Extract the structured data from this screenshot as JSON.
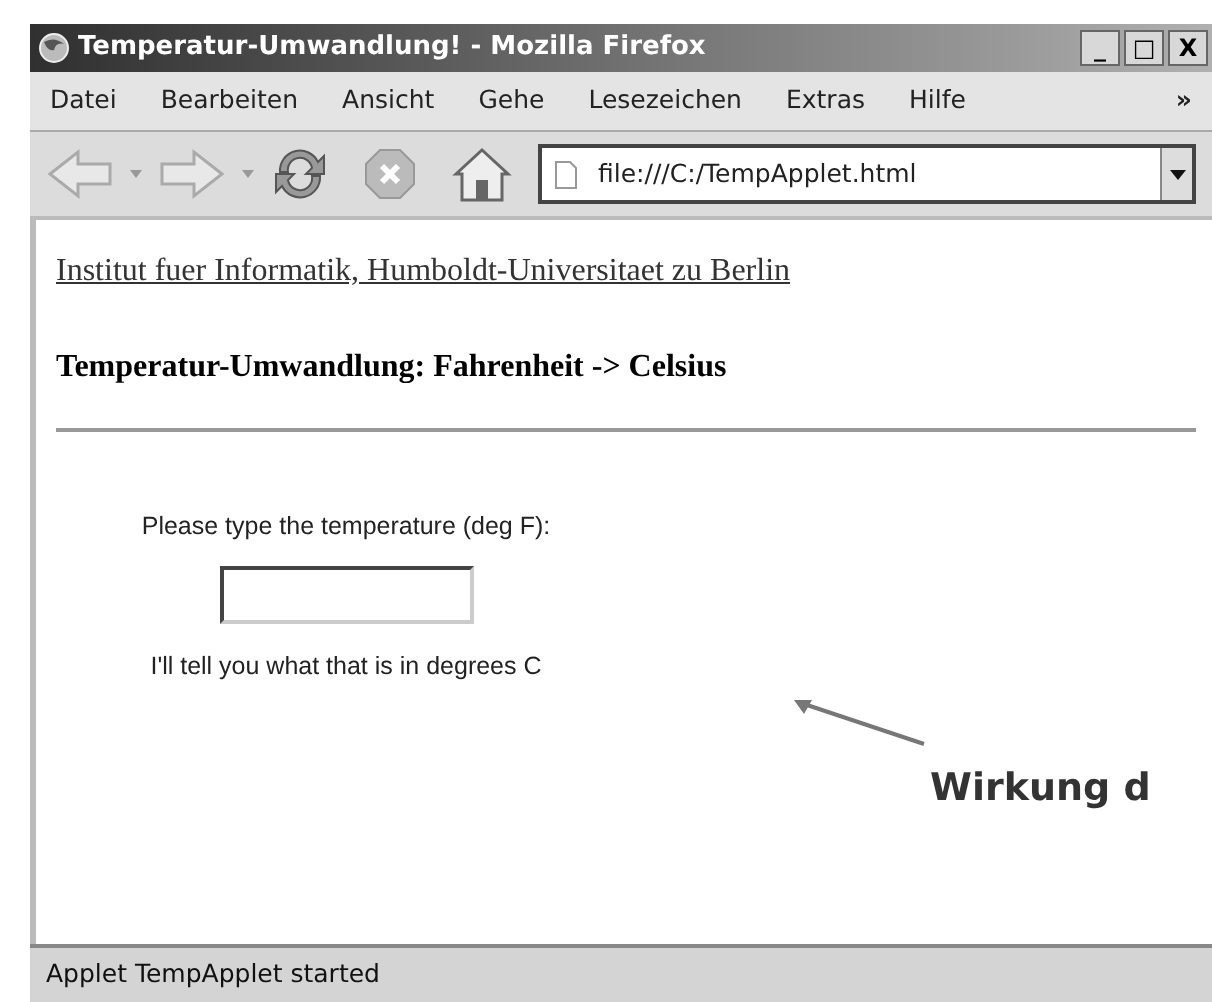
{
  "window": {
    "title": "Temperatur-Umwandlung! - Mozilla Firefox",
    "controls": [
      "_",
      "□",
      "X"
    ]
  },
  "menu": {
    "items": [
      "Datei",
      "Bearbeiten",
      "Ansicht",
      "Gehe",
      "Lesezeichen",
      "Extras",
      "Hilfe"
    ],
    "overflow": "»"
  },
  "toolbar": {
    "address": "file:///C:/TempApplet.html"
  },
  "page": {
    "link": "Institut fuer Informatik, Humboldt-Universitaet zu Berlin",
    "heading": "Temperatur-Umwandlung: Fahrenheit -> Celsius",
    "applet": {
      "prompt": "Please type the temperature (deg F):",
      "result": "I'll tell you what that is in degrees C"
    }
  },
  "annotation": "Wirkung d",
  "status_bar": "Applet TempApplet started"
}
